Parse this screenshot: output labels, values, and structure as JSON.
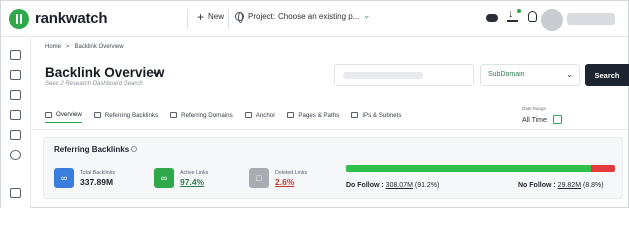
{
  "app": {
    "brand": "rankwatch",
    "new_label": "New",
    "project_label": "Project:",
    "project_value": "Choose an existing p..."
  },
  "topbar_icons": [
    "cloud-download-icon",
    "download-notify-icon",
    "bulb-icon"
  ],
  "breadcrumb": {
    "home": "Home",
    "sep": ">",
    "current": "Backlink Overview"
  },
  "page": {
    "title": "Backlink Overview",
    "subtitle": "Sees 2 Research Dashboard Search"
  },
  "search": {
    "select_value": "SubDomain",
    "button_label": "Search"
  },
  "tabs": [
    {
      "label": "Overview",
      "icon": "chart-icon",
      "active": true
    },
    {
      "label": "Referring Backlinks",
      "icon": "link-icon",
      "active": false
    },
    {
      "label": "Referring Domains",
      "icon": "domains-icon",
      "active": false
    },
    {
      "label": "Anchor",
      "icon": "anchor-icon",
      "active": false
    },
    {
      "label": "Pages & Paths",
      "icon": "pages-icon",
      "active": false
    },
    {
      "label": "IPs & Subnets",
      "icon": "ip-icon",
      "active": false
    }
  ],
  "date_range": {
    "label": "Date Range",
    "value": "All Time"
  },
  "referring_backlinks": {
    "title": "Referring Backlinks",
    "stats": [
      {
        "label": "Total Backlinks",
        "value": "337.89M",
        "color": "#3b7ddd",
        "icon": "link-icon"
      },
      {
        "label": "Active Links",
        "value": "97.4%",
        "color": "#2fa84a",
        "icon": "active-link-icon"
      },
      {
        "label": "Deleted Links",
        "value": "2.6%",
        "color": "#a8abb2",
        "icon": "trash-icon"
      }
    ],
    "dofollow": {
      "label": "Do Follow :",
      "value": "308.07M",
      "pct": "(91.2%)",
      "fraction": 0.912,
      "color": "#2fbf4a"
    },
    "nofollow": {
      "label": "No Follow :",
      "value": "29.82M",
      "pct": "(8.8%)",
      "fraction": 0.088,
      "color": "#e23b3b"
    }
  }
}
